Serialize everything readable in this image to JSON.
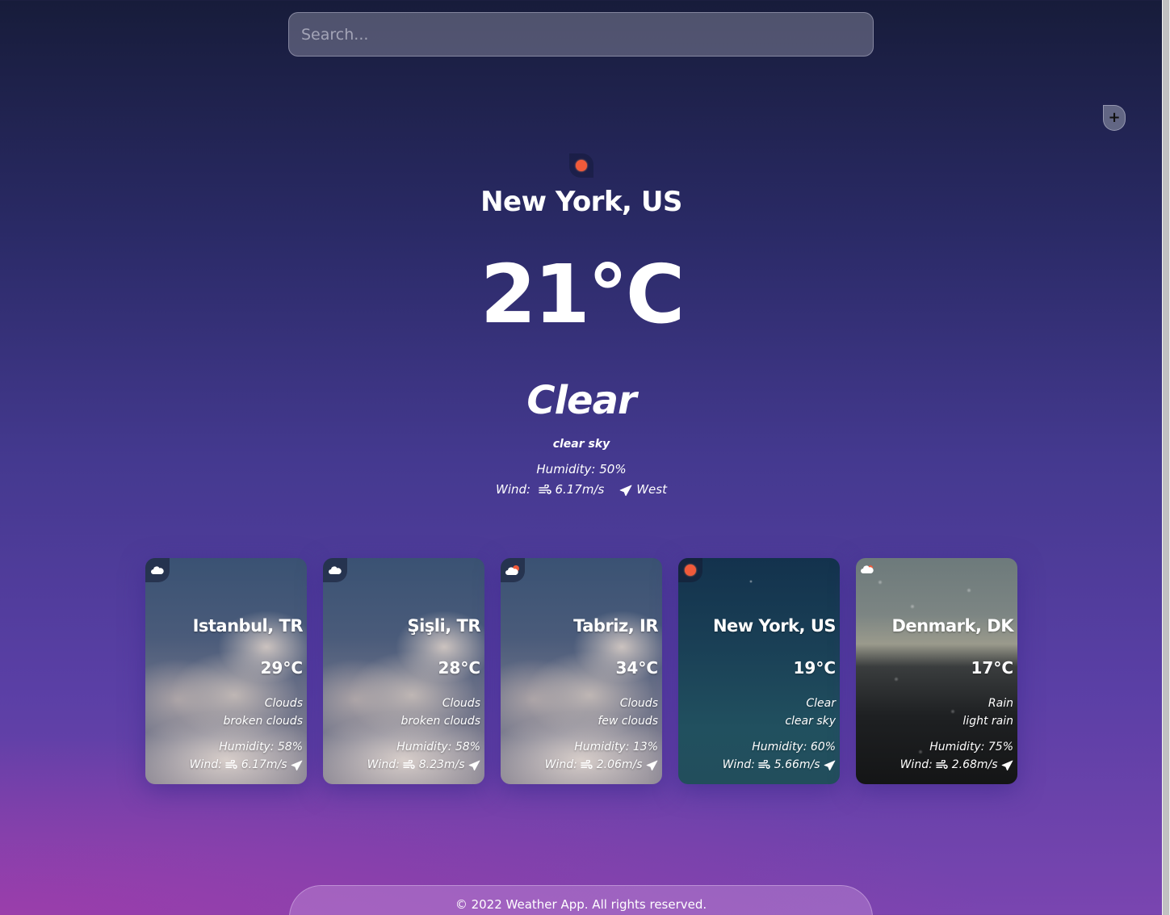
{
  "search": {
    "placeholder": "Search..."
  },
  "add_button": {
    "label": "+"
  },
  "current": {
    "icon": "clear-sun-icon",
    "city": "New York, US",
    "temp": "21°C",
    "condition": "Clear",
    "description": "clear sky",
    "humidity": "Humidity: 50%",
    "wind_label": "Wind:",
    "wind_speed": "6.17m/s",
    "wind_direction": "West"
  },
  "cards": [
    {
      "icon": "cloud-icon",
      "city": "Istanbul, TR",
      "temp": "29°C",
      "condition": "Clouds",
      "description": "broken clouds",
      "humidity": "Humidity: 58%",
      "wind_label": "Wind:",
      "wind_speed": "6.17m/s"
    },
    {
      "icon": "cloud-icon",
      "city": "Şişli, TR",
      "temp": "28°C",
      "condition": "Clouds",
      "description": "broken clouds",
      "humidity": "Humidity: 58%",
      "wind_label": "Wind:",
      "wind_speed": "8.23m/s"
    },
    {
      "icon": "cloud-sun-icon",
      "city": "Tabriz, IR",
      "temp": "34°C",
      "condition": "Clouds",
      "description": "few clouds",
      "humidity": "Humidity: 13%",
      "wind_label": "Wind:",
      "wind_speed": "2.06m/s"
    },
    {
      "icon": "clear-sun-icon",
      "city": "New York, US",
      "temp": "19°C",
      "condition": "Clear",
      "description": "clear sky",
      "humidity": "Humidity: 60%",
      "wind_label": "Wind:",
      "wind_speed": "5.66m/s"
    },
    {
      "icon": "rain-cloud-icon",
      "city": "Denmark, DK",
      "temp": "17°C",
      "condition": "Rain",
      "description": "light rain",
      "humidity": "Humidity: 75%",
      "wind_label": "Wind:",
      "wind_speed": "2.68m/s"
    }
  ],
  "footer": {
    "text": "© 2022 Weather App. All rights reserved."
  },
  "colors": {
    "sun": "#f05a3a",
    "text": "#ffffff"
  }
}
